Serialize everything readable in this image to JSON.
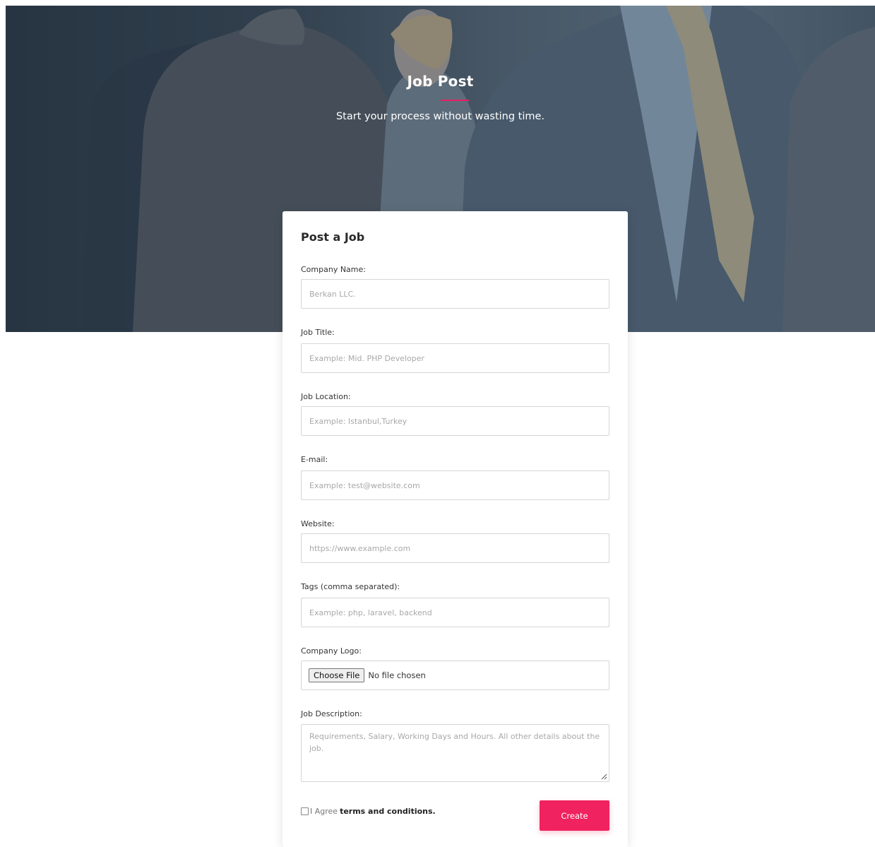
{
  "hero": {
    "title": "Job Post",
    "subtitle": "Start your process without wasting time.",
    "background_image": "business-people-in-suits"
  },
  "form": {
    "title": "Post a Job",
    "fields": {
      "company_name": {
        "label": "Company Name:",
        "placeholder": "Berkan LLC."
      },
      "job_title": {
        "label": "Job Title:",
        "placeholder": "Example: Mid. PHP Developer"
      },
      "job_location": {
        "label": "Job Location:",
        "placeholder": "Example: Istanbul,Turkey"
      },
      "email": {
        "label": "E-mail:",
        "placeholder": "Example: test@website.com"
      },
      "website": {
        "label": "Website:",
        "placeholder": "https://www.example.com"
      },
      "tags": {
        "label": "Tags (comma separated):",
        "placeholder": "Example: php, laravel, backend"
      },
      "company_logo": {
        "label": "Company Logo:",
        "button": "Choose File",
        "status": "No file chosen"
      },
      "job_description": {
        "label": "Job Description:",
        "placeholder": "Requirements, Salary, Working Days and Hours. All other details about the job."
      }
    },
    "agree": {
      "prefix": "I Agree",
      "link": "terms and conditions."
    },
    "submit_label": "Create"
  },
  "colors": {
    "accent": "#f0225f",
    "hero_overlay": "#3b4957"
  }
}
